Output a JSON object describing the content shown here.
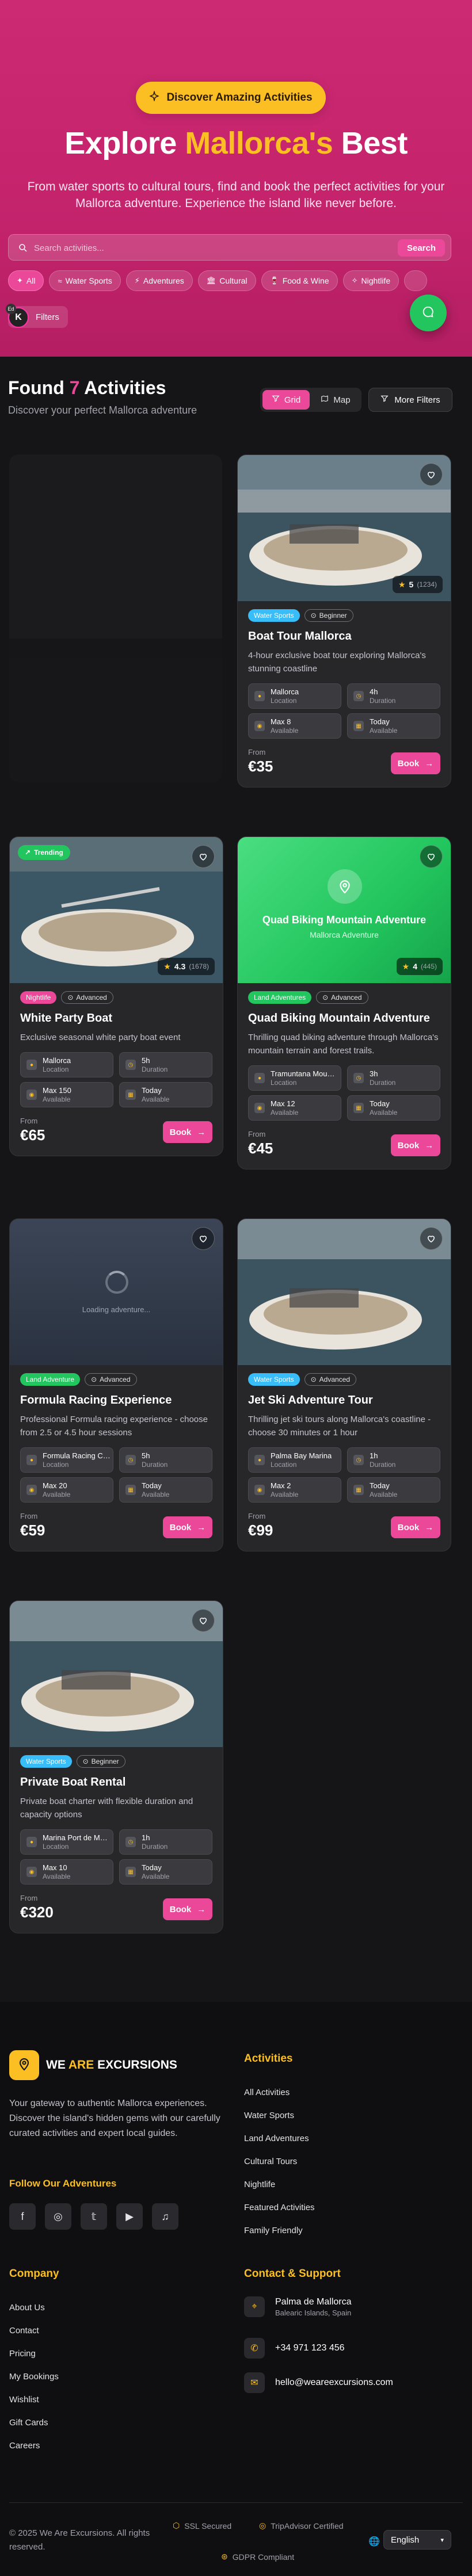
{
  "hero": {
    "badge": "Discover Amazing Activities",
    "title_pre": "Explore ",
    "title_accent": "Mallorca's",
    "title_post": " Best",
    "subtitle": "From water sports to cultural tours, find and book the perfect activities for your Mallorca adventure. Experience the island like never before."
  },
  "search": {
    "placeholder": "Search activities...",
    "button": "Search"
  },
  "categories": [
    {
      "icon": "✦",
      "label": "All"
    },
    {
      "icon": "≈",
      "label": "Water Sports"
    },
    {
      "icon": "⚡",
      "label": "Adventures"
    },
    {
      "icon": "🏛",
      "label": "Cultural"
    },
    {
      "icon": "🍷",
      "label": "Food & Wine"
    },
    {
      "icon": "✧",
      "label": "Nightlife"
    }
  ],
  "filters_label": "Filters",
  "avatar_letter": "K",
  "avatar_badge": "Ed",
  "results": {
    "found_pre": "Found ",
    "count": "7",
    "found_post": " Activities",
    "subtitle": "Discover your perfect Mallorca adventure",
    "grid": "Grid",
    "map": "Map",
    "more_filters": "More Filters"
  },
  "cards": [
    {
      "category": "Water Sports",
      "cat_color": "#38bdf8",
      "level": "Beginner",
      "title": "Boat Tour Mallorca",
      "desc": "4-hour exclusive boat tour exploring Mallorca's stunning coastline",
      "location": "Mallorca",
      "duration": "4h",
      "max": "Max 8",
      "avail": "Today",
      "price": "€35",
      "rating": "5",
      "rating_count": "(1234)"
    },
    {
      "category": "Nightlife",
      "cat_color": "#ec4899",
      "level": "Advanced",
      "title": "White Party Boat",
      "desc": "Exclusive seasonal white party boat event",
      "location": "Mallorca",
      "duration": "5h",
      "max": "Max 150",
      "avail": "Today",
      "price": "€65",
      "rating": "4.3",
      "rating_count": "(1678)",
      "trending": "Trending"
    },
    {
      "category": "Land Adventures",
      "cat_color": "#22c55e",
      "level": "Advanced",
      "title": "Quad Biking Mountain Adventure",
      "desc": "Thrilling quad biking adventure through Mallorca's mountain terrain and forest trails.",
      "location": "Tramuntana Mountains",
      "duration": "3h",
      "max": "Max 12",
      "avail": "Today",
      "price": "€45",
      "rating": "4",
      "rating_count": "(445)",
      "placeholder_title": "Quad Biking Mountain Adventure",
      "placeholder_sub": "Mallorca Adventure"
    },
    {
      "category": "Land Adventure",
      "cat_color": "#22c55e",
      "level": "Advanced",
      "title": "Formula Racing Experience",
      "desc": "Professional Formula racing experience - choose from 2.5 or 4.5 hour sessions",
      "location": "Formula Racing Circuit",
      "duration": "5h",
      "max": "Max 20",
      "avail": "Today",
      "price": "€59",
      "loading": "Loading adventure..."
    },
    {
      "category": "Water Sports",
      "cat_color": "#38bdf8",
      "level": "Advanced",
      "title": "Jet Ski Adventure Tour",
      "desc": "Thrilling jet ski tours along Mallorca's coastline - choose 30 minutes or 1 hour",
      "location": "Palma Bay Marina",
      "duration": "1h",
      "max": "Max 2",
      "avail": "Today",
      "price": "€99"
    },
    {
      "category": "Water Sports",
      "cat_color": "#38bdf8",
      "level": "Beginner",
      "title": "Private Boat Rental",
      "desc": "Private boat charter with flexible duration and capacity options",
      "location": "Marina Port de Mallorca",
      "duration": "1h",
      "max": "Max 10",
      "avail": "Today",
      "price": "€320"
    }
  ],
  "labels": {
    "location": "Location",
    "duration": "Duration",
    "available": "Available",
    "from": "From",
    "book": "Book"
  },
  "footer": {
    "brand_we": "WE ",
    "brand_are": "ARE",
    "brand_ex": " EXCURSIONS",
    "desc": "Your gateway to authentic Mallorca experiences. Discover the island's hidden gems with our carefully curated activities and expert local guides.",
    "follow": "Follow Our Adventures",
    "activities_title": "Activities",
    "activities": [
      "All Activities",
      "Water Sports",
      "Land Adventures",
      "Cultural Tours",
      "Nightlife",
      "Featured Activities",
      "Family Friendly"
    ],
    "company_title": "Company",
    "company": [
      "About Us",
      "Contact",
      "Pricing",
      "My Bookings",
      "Wishlist",
      "Gift Cards",
      "Careers"
    ],
    "contact_title": "Contact & Support",
    "address_main": "Palma de Mallorca",
    "address_sub": "Balearic Islands, Spain",
    "phone": "+34 971 123 456",
    "email": "hello@weareexcursions.com",
    "copyright": "© 2025 We Are Excursions. All rights reserved.",
    "ssl": "SSL Secured",
    "tripadvisor": "TripAdvisor Certified",
    "gdpr": "GDPR Compliant",
    "language": "English"
  }
}
